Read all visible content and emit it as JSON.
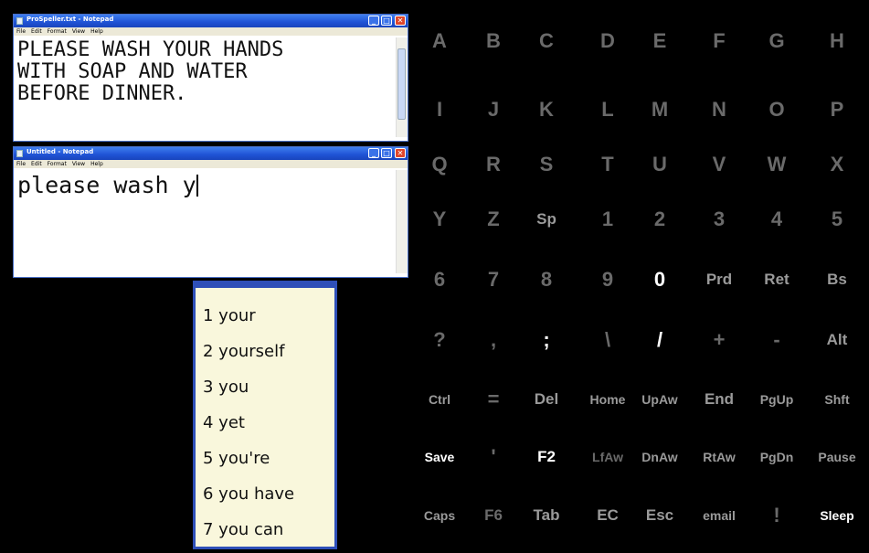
{
  "window_top": {
    "title": "ProSpeller.txt - Notepad",
    "menu": [
      "File",
      "Edit",
      "Format",
      "View",
      "Help"
    ],
    "text": "PLEASE WASH YOUR HANDS\nWITH SOAP AND WATER\nBEFORE DINNER."
  },
  "window_bottom": {
    "title": "Untitled - Notepad",
    "menu": [
      "File",
      "Edit",
      "Format",
      "View",
      "Help"
    ],
    "text": "please wash y"
  },
  "window_buttons": {
    "minimize": "_",
    "maximize": "□",
    "close": "✕"
  },
  "predictions": [
    "1 your",
    "2 yourself",
    "3 you",
    "4 yet",
    "5 you're",
    "6 you have",
    "7 you can"
  ],
  "keyboard": {
    "rows": [
      [
        "A",
        "B",
        "C",
        "D",
        "E",
        "F",
        "G",
        "H"
      ],
      [
        "I",
        "J",
        "K",
        "L",
        "M",
        "N",
        "O",
        "P"
      ],
      [
        "Q",
        "R",
        "S",
        "T",
        "U",
        "V",
        "W",
        "X"
      ],
      [
        "Y",
        "Z",
        "Sp",
        "1",
        "2",
        "3",
        "4",
        "5"
      ],
      [
        "6",
        "7",
        "8",
        "9",
        "0",
        "Prd",
        "Ret",
        "Bs"
      ],
      [
        "?",
        ",",
        ";",
        "\\",
        "/",
        "+",
        "-",
        "Alt"
      ],
      [
        "Ctrl",
        "=",
        "Del",
        "Home",
        "UpAw",
        "End",
        "PgUp",
        "Shft"
      ],
      [
        "Save",
        "'",
        "F2",
        "LfAw",
        "DnAw",
        "RtAw",
        "PgDn",
        "Pause"
      ],
      [
        "Caps",
        "F6",
        "Tab",
        "EC",
        "Esc",
        "email",
        "!",
        "Sleep"
      ]
    ],
    "colors": {
      "dim": "#6a6a6a",
      "bright": "#ffffff",
      "mid": "#9a9a9a"
    }
  }
}
